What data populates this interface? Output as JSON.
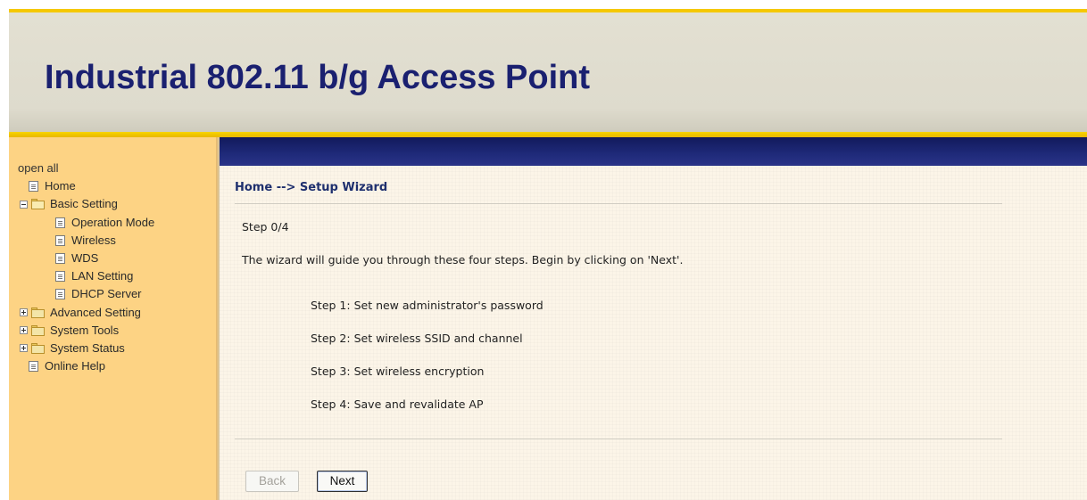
{
  "header": {
    "title": "Industrial 802.11 b/g Access Point"
  },
  "sidebar": {
    "open_all": "open all",
    "items": [
      {
        "label": "Home",
        "type": "page"
      },
      {
        "label": "Basic Setting",
        "type": "folder-open"
      },
      {
        "label": "Operation Mode",
        "type": "page"
      },
      {
        "label": "Wireless",
        "type": "page"
      },
      {
        "label": "WDS",
        "type": "page"
      },
      {
        "label": "LAN Setting",
        "type": "page"
      },
      {
        "label": "DHCP Server",
        "type": "page"
      },
      {
        "label": "Advanced Setting",
        "type": "folder-closed"
      },
      {
        "label": "System Tools",
        "type": "folder-closed"
      },
      {
        "label": "System Status",
        "type": "folder-closed"
      },
      {
        "label": "Online Help",
        "type": "page"
      }
    ]
  },
  "main": {
    "breadcrumb": "Home --> Setup Wizard",
    "step_count": "Step 0/4",
    "intro": "The wizard will guide you through these four steps. Begin by clicking on 'Next'.",
    "steps": [
      "Step 1: Set new administrator's password",
      "Step 2: Set wireless SSID and channel",
      "Step 3: Set wireless encryption",
      "Step 4: Save and revalidate AP"
    ],
    "buttons": {
      "back": "Back",
      "next": "Next"
    }
  },
  "colors": {
    "header_title": "#1a2070",
    "sidebar_bg": "#fdd384",
    "navy_band": "#1f2a7a",
    "accent_yellow": "#f5c800"
  }
}
